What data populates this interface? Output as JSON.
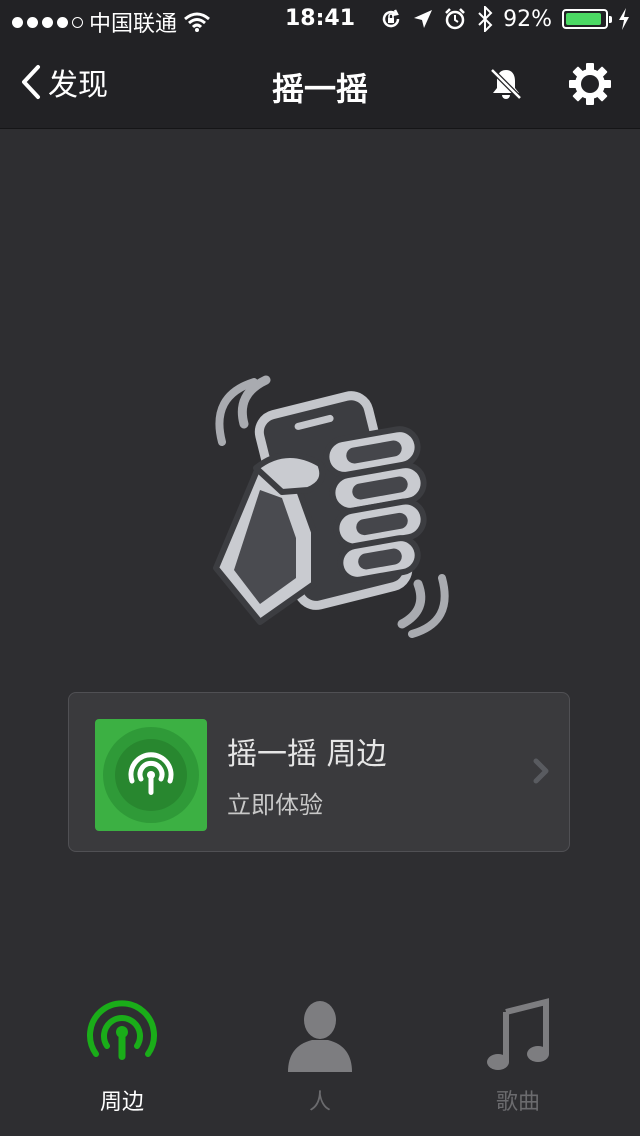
{
  "status_bar": {
    "carrier": "中国联通",
    "time": "18:41",
    "battery_percent": "92%",
    "battery_level": 0.92,
    "signal_dots_filled": 4,
    "signal_dots_total": 5
  },
  "navbar": {
    "back_label": "发现",
    "title": "摇一摇"
  },
  "card": {
    "title": "摇一摇 周边",
    "subtitle": "立即体验"
  },
  "tabs": [
    {
      "label": "周边",
      "icon": "beacon-icon",
      "active": true
    },
    {
      "label": "人",
      "icon": "person-icon",
      "active": false
    },
    {
      "label": "歌曲",
      "icon": "music-note-icon",
      "active": false
    }
  ],
  "colors": {
    "accent": "#1aad19",
    "card_icon_bg": "#3cb043",
    "background": "#2e2e31",
    "header": "#222225",
    "inactive_tab": "#7d7d80"
  }
}
